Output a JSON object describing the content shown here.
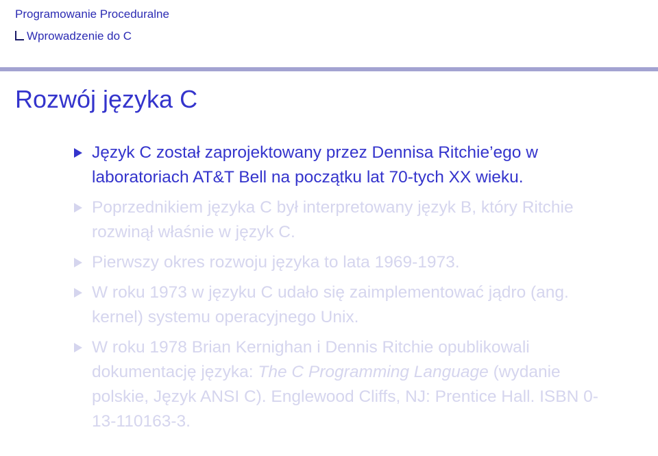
{
  "header": {
    "section": "Programowanie Proceduralne",
    "subsection": "Wprowadzenie do C"
  },
  "frame": {
    "title": "Rozwój języka C"
  },
  "items": [
    {
      "text": "Język C został zaprojektowany przez Dennisa Ritchie’ego w laboratoriach AT&T Bell na początku lat 70-tych XX wieku."
    },
    {
      "text": "Poprzednikiem języka C był interpretowany język B, który Ritchie rozwinął właśnie w język C."
    },
    {
      "text": "Pierwszy okres rozwoju języka to lata 1969-1973."
    },
    {
      "text": "W roku 1973 w języku C udało się zaimplementować jądro (ang. kernel) systemu operacyjnego Unix."
    },
    {
      "text_before": "W roku 1978 Brian Kernighan i Dennis Ritchie opublikowali dokumentację języka: ",
      "text_italic": "The C Programming Language",
      "text_after": " (wydanie polskie, Język ANSI C). Englewood Cliffs, NJ: Prentice Hall. ISBN 0-13-110163-3."
    }
  ],
  "colors": {
    "accent": "#3434cc",
    "header": "#2b2bb3",
    "dimmed": "#d5d5ee",
    "rule": "#a3a3d1"
  }
}
